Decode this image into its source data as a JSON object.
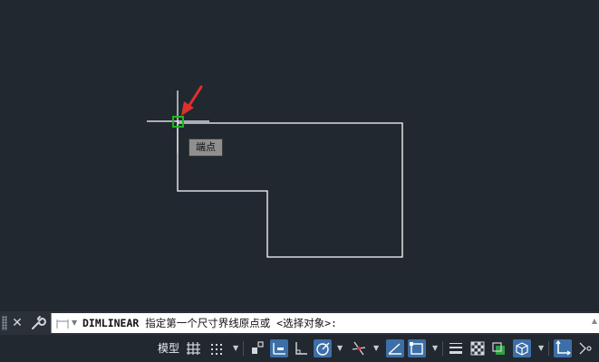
{
  "canvas": {
    "snap_tooltip": "端点",
    "colors": {
      "background": "#212830",
      "geometry": "#ffffff",
      "snap_marker": "#1fb51f",
      "arrow": "#e0302b"
    }
  },
  "command_line": {
    "command": "DIMLINEAR",
    "prompt": " 指定第一个尺寸界线原点或 <选择对象>:",
    "close_icon": "close-icon",
    "customize_icon": "wrench-icon"
  },
  "status_bar": {
    "model_tab": "模型",
    "accent_color": "#3c6fa8",
    "buttons": [
      {
        "name": "grid-display",
        "icon": "grid-icon",
        "active": false
      },
      {
        "name": "snap-mode",
        "icon": "snap-grid-icon",
        "active": false
      },
      {
        "name": "infer-constraints",
        "icon": "infer-icon",
        "active": false
      },
      {
        "name": "dynamic-input",
        "icon": "dynamic-input-icon",
        "active": true
      },
      {
        "name": "ortho-mode",
        "icon": "ortho-icon",
        "active": false
      },
      {
        "name": "polar-tracking",
        "icon": "polar-icon",
        "active": true
      },
      {
        "name": "isometric-drafting",
        "icon": "isometric-icon",
        "active": false
      },
      {
        "name": "object-snap-tracking",
        "icon": "snap-tracking-icon",
        "active": true
      },
      {
        "name": "object-snap",
        "icon": "object-snap-icon",
        "active": true
      },
      {
        "name": "lineweight",
        "icon": "lineweight-icon",
        "active": false
      },
      {
        "name": "transparency",
        "icon": "transparency-icon",
        "active": false
      },
      {
        "name": "selection-cycling",
        "icon": "selection-cycling-icon",
        "active": false
      },
      {
        "name": "3d-object-snap",
        "icon": "3d-snap-icon",
        "active": true
      },
      {
        "name": "dynamic-ucs",
        "icon": "ucs-icon",
        "active": true
      }
    ]
  }
}
